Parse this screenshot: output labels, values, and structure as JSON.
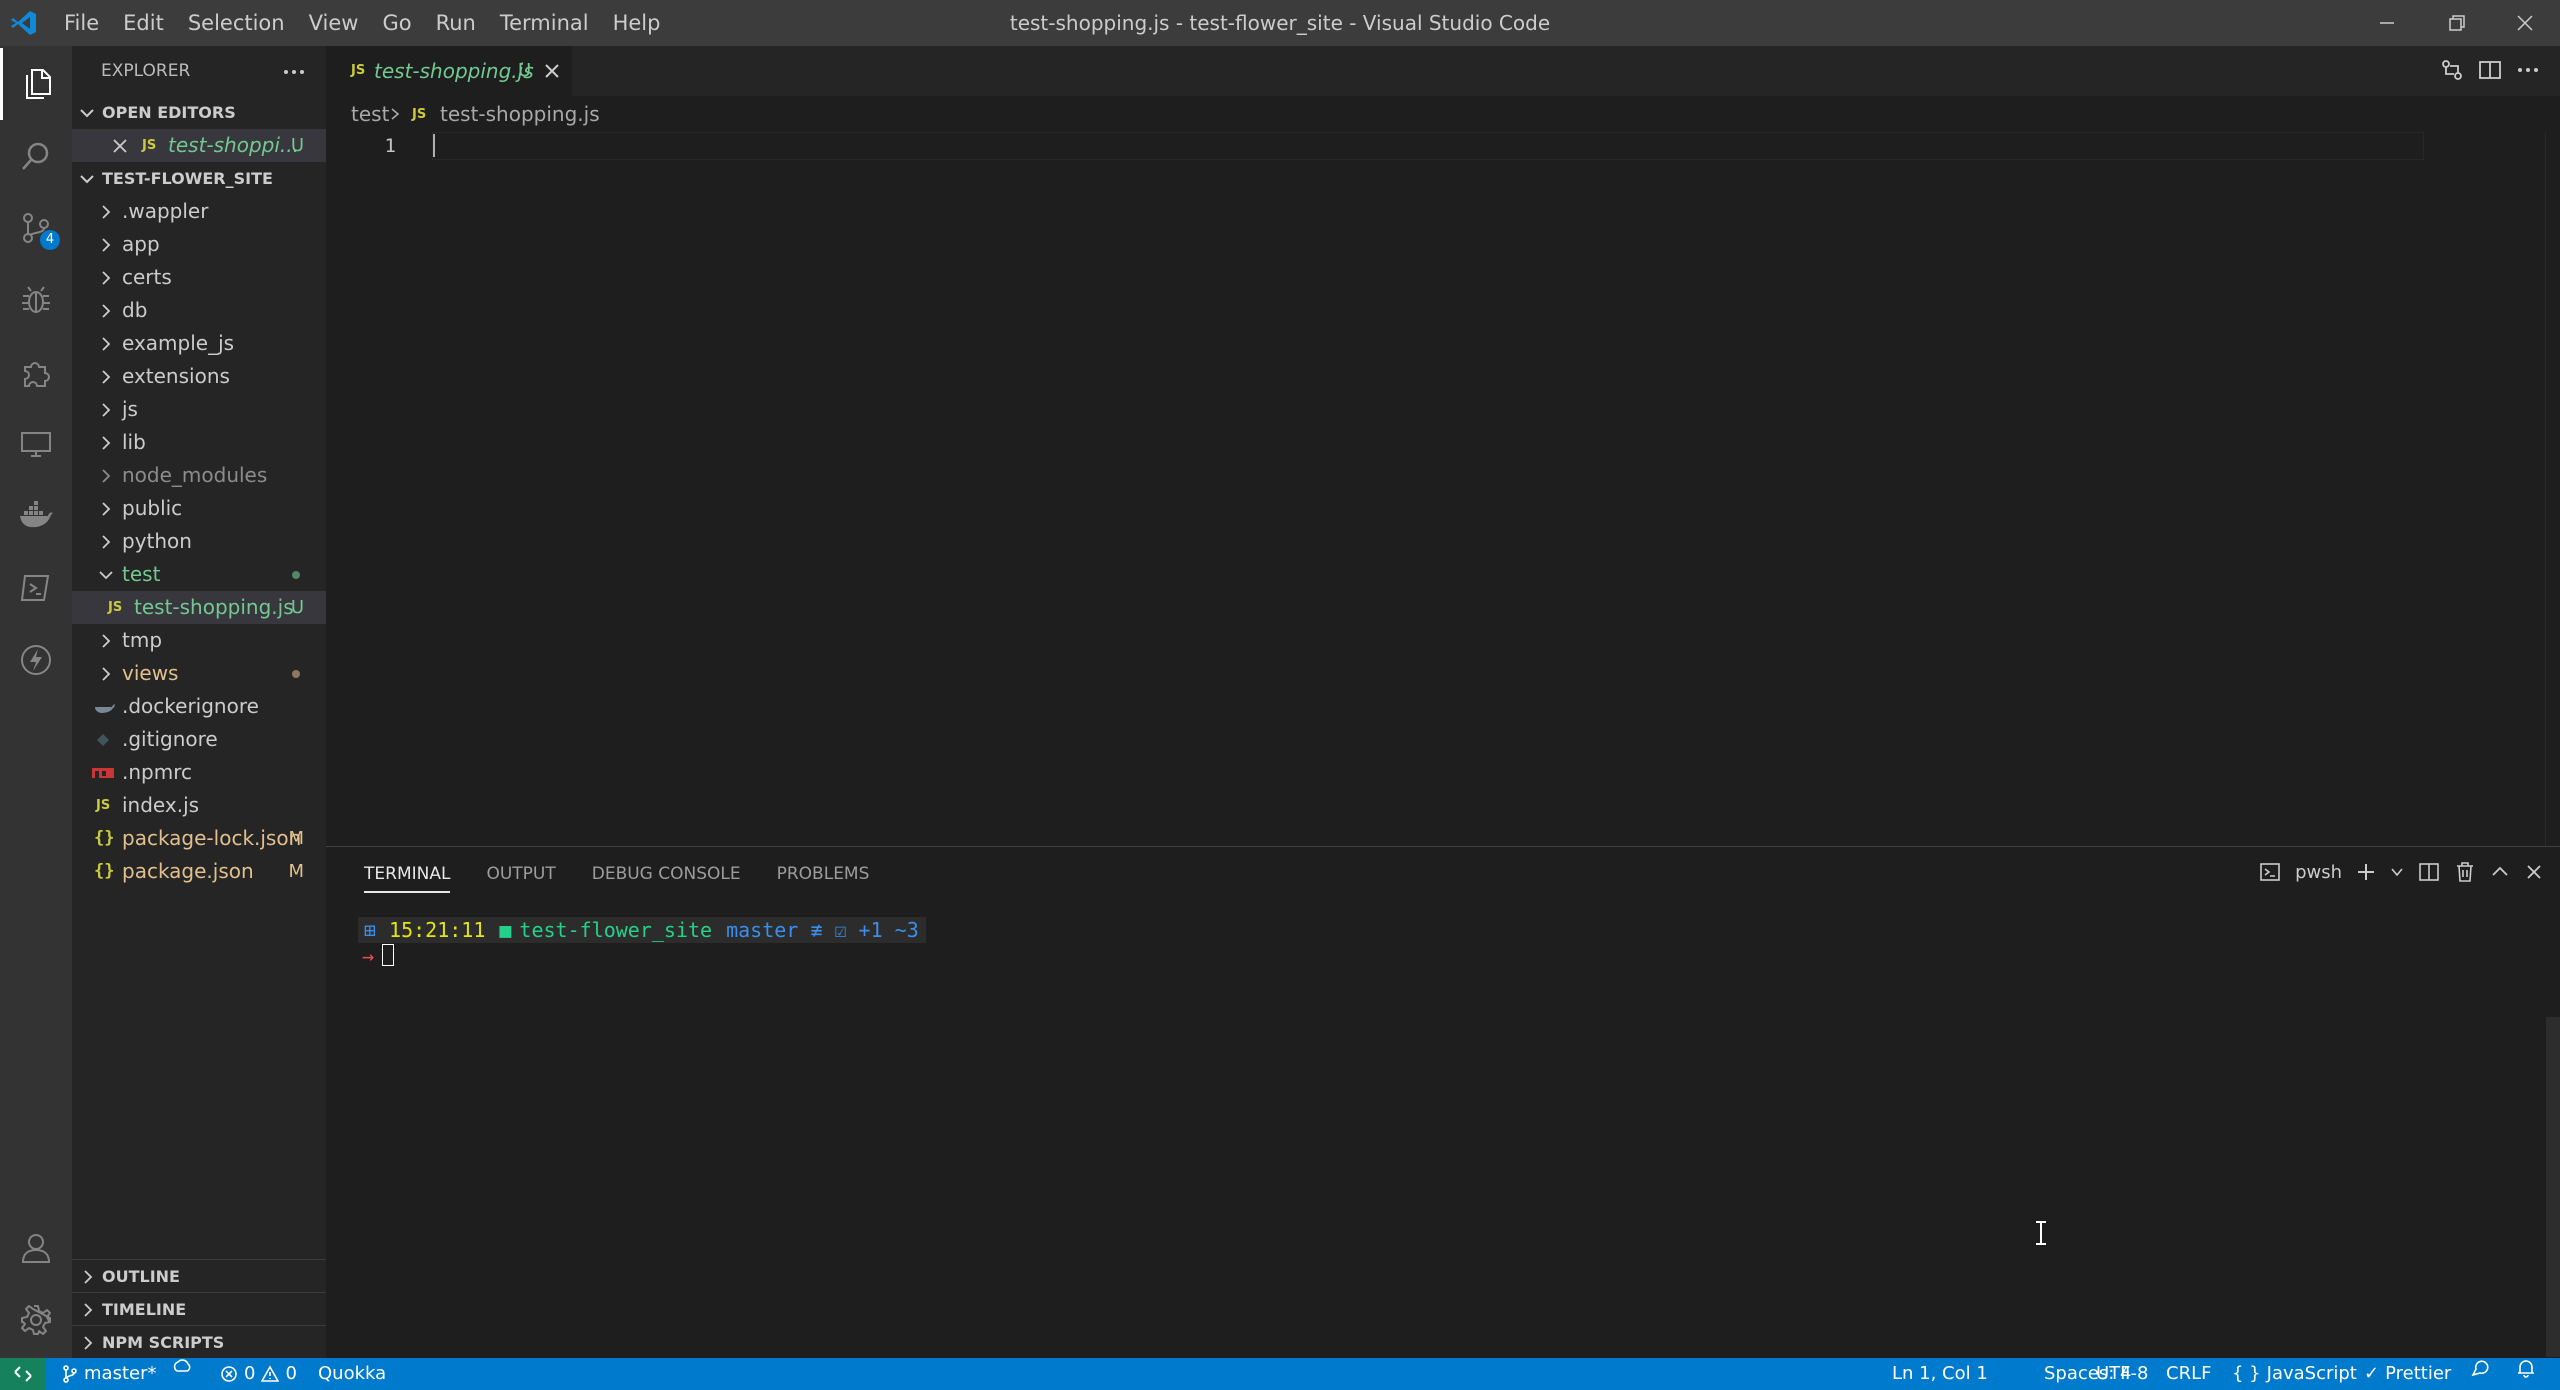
{
  "window": {
    "title": "test-shopping.js - test-flower_site - Visual Studio Code",
    "menu": [
      "File",
      "Edit",
      "Selection",
      "View",
      "Go",
      "Run",
      "Terminal",
      "Help"
    ]
  },
  "activity_bar": {
    "items": [
      "files-icon",
      "search-icon",
      "source-control-icon",
      "debug-icon",
      "extensions-icon",
      "remote-explorer-icon",
      "docker-icon",
      "test-icon",
      "quokka-icon"
    ],
    "source_control_badge": "4"
  },
  "sidebar": {
    "title": "EXPLORER",
    "open_editors_label": "OPEN EDITORS",
    "open_editor": {
      "name": "test-shoppi...",
      "status": "U"
    },
    "folder_label": "TEST-FLOWER_SITE",
    "tree": [
      {
        "name": ".wappler",
        "type": "folder"
      },
      {
        "name": "app",
        "type": "folder"
      },
      {
        "name": "certs",
        "type": "folder"
      },
      {
        "name": "db",
        "type": "folder"
      },
      {
        "name": "example_js",
        "type": "folder"
      },
      {
        "name": "extensions",
        "type": "folder"
      },
      {
        "name": "js",
        "type": "folder"
      },
      {
        "name": "lib",
        "type": "folder"
      },
      {
        "name": "node_modules",
        "type": "folder"
      },
      {
        "name": "public",
        "type": "folder"
      },
      {
        "name": "python",
        "type": "folder"
      },
      {
        "name": "test",
        "type": "folder-open"
      },
      {
        "name": "test-shopping.js",
        "type": "js",
        "status": "U"
      },
      {
        "name": "tmp",
        "type": "folder"
      },
      {
        "name": "views",
        "type": "folder"
      },
      {
        "name": ".dockerignore",
        "type": "file"
      },
      {
        "name": ".gitignore",
        "type": "file"
      },
      {
        "name": ".npmrc",
        "type": "file"
      },
      {
        "name": "index.js",
        "type": "js"
      },
      {
        "name": "package-lock.json",
        "type": "json",
        "status": "M"
      },
      {
        "name": "package.json",
        "type": "json",
        "status": "M"
      }
    ],
    "bottom_sections": [
      "OUTLINE",
      "TIMELINE",
      "NPM SCRIPTS"
    ]
  },
  "editor": {
    "tab": {
      "label": "test-shopping.js",
      "status": "U"
    },
    "breadcrumb": {
      "folder": "test",
      "file": "test-shopping.js"
    },
    "line_number": "1"
  },
  "panel": {
    "tabs": [
      "TERMINAL",
      "OUTPUT",
      "DEBUG CONSOLE",
      "PROBLEMS"
    ],
    "shell": "pwsh",
    "prompt": {
      "time": "15:21:11",
      "folder": "test-flower_site",
      "branch": "master ≢ ☑ +1 ~3",
      "arrow": "→"
    }
  },
  "status_bar": {
    "branch": "master*",
    "errors": "0",
    "warnings": "0",
    "quokka": "Quokka",
    "position": "Ln 1, Col 1",
    "spaces": "Spaces: 4",
    "encoding": "UTF-8",
    "eol": "CRLF",
    "language": "JavaScript",
    "formatter": "Prettier"
  },
  "colors": {
    "accent": "#007acc",
    "untracked": "#73c991",
    "modified": "#e2c08d",
    "js_icon": "#cbcb41"
  }
}
